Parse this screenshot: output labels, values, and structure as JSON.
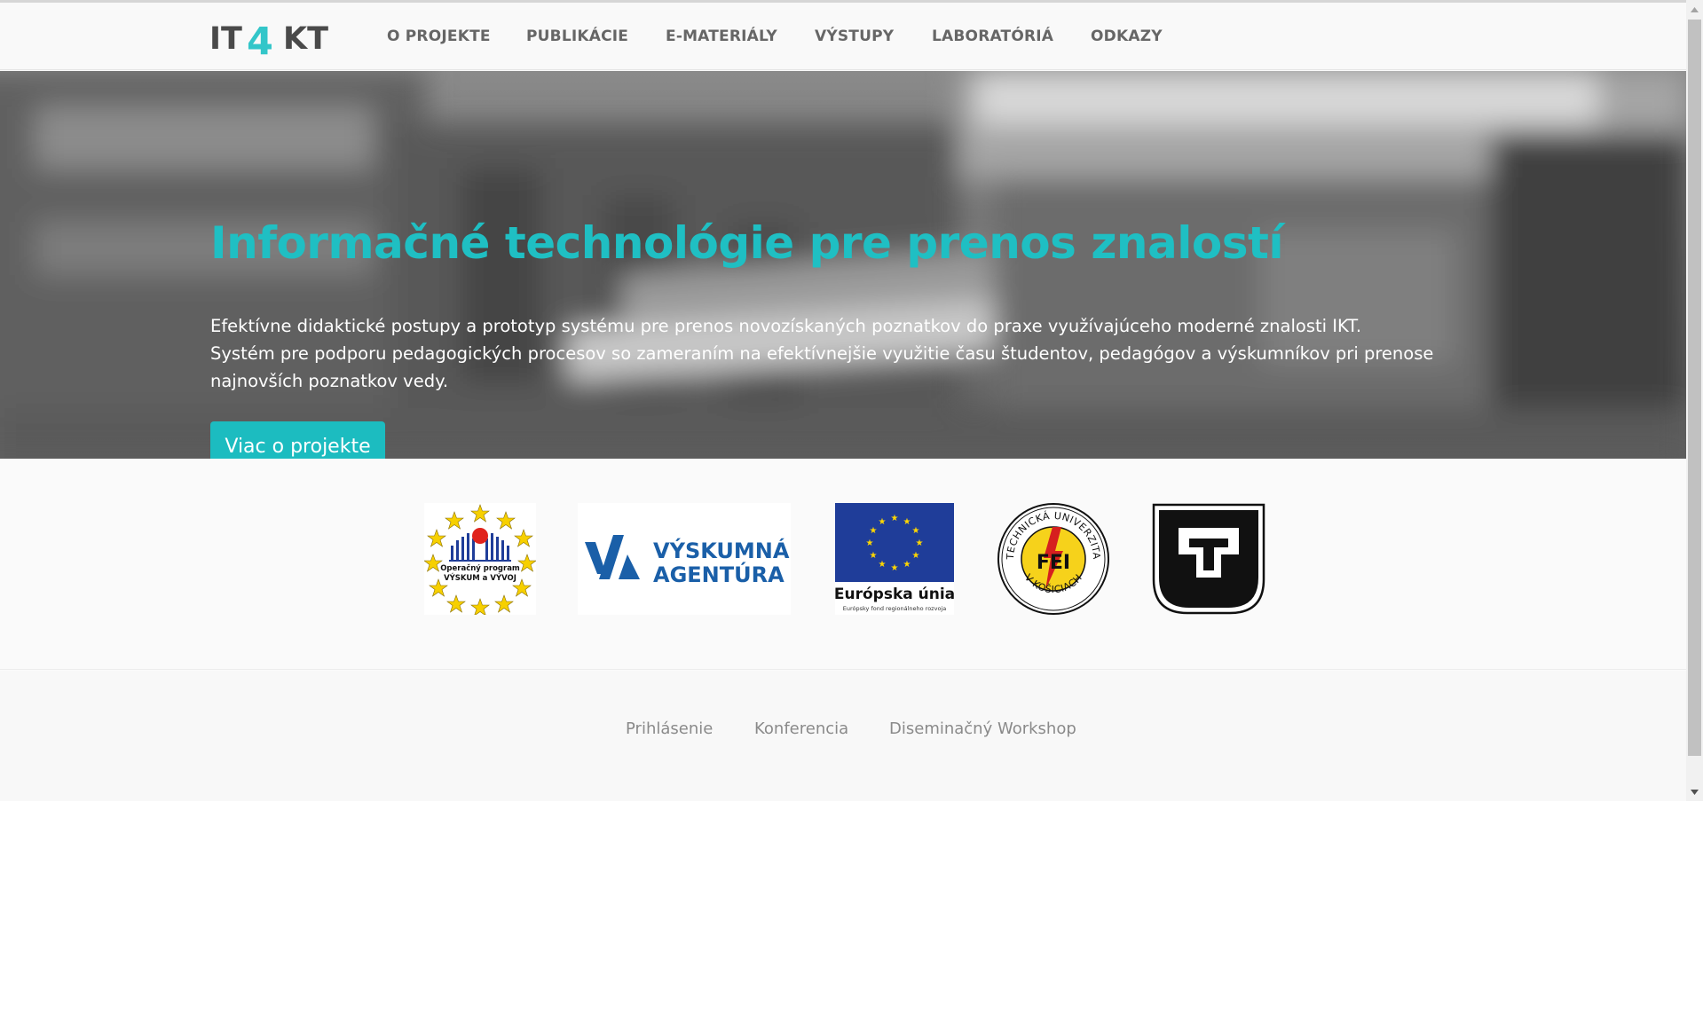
{
  "navbar": {
    "logo": {
      "text_before": "IT",
      "digit": "4",
      "text_after": "KT"
    },
    "items": [
      {
        "label": "O PROJEKTE"
      },
      {
        "label": "PUBLIKÁCIE"
      },
      {
        "label": "E-MATERIÁLY"
      },
      {
        "label": "VÝSTUPY"
      },
      {
        "label": "LABORATÓRIÁ"
      },
      {
        "label": "ODKAZY"
      }
    ]
  },
  "hero": {
    "title": "Informačné technológie pre prenos znalostí",
    "lines": [
      "Efektívne didaktické postupy a prototyp systému pre prenos novozískaných poznatkov do praxe využívajúceho moderné znalosti IKT.",
      "Systém pre podporu pedagogických procesov so zameraním na efektívnejšie využitie času študentov, pedagógov a výskumníkov pri prenose",
      "najnovších poznatkov vedy."
    ],
    "button_label": "Viac o projekte"
  },
  "logos": {
    "opvav": {
      "line1": "Operačný program",
      "line2": "VÝSKUM a VÝVOJ"
    },
    "va": {
      "line1": "VÝSKUMNÁ",
      "line2": "AGENTÚRA"
    },
    "eu": {
      "title": "Európska únia",
      "subtitle": "Európsky fond regionálneho rozvoja"
    },
    "fei": {
      "arc_top": "TECHNICKÁ UNIVERZITA",
      "arc_bottom": "V KOŠICIACH",
      "letters": "FEI"
    },
    "tuke": {}
  },
  "footer": {
    "links": [
      {
        "label": "Prihlásenie"
      },
      {
        "label": "Konferencia"
      },
      {
        "label": "Diseminačný Workshop"
      }
    ]
  },
  "colors": {
    "accent": "#1fbfc3",
    "nav_text": "#666666",
    "va_blue": "#1a5fa8",
    "eu_blue": "#1f3d99",
    "eu_star": "#ffd700",
    "fei_red": "#d61f1f",
    "fei_yellow": "#f6d21b"
  }
}
